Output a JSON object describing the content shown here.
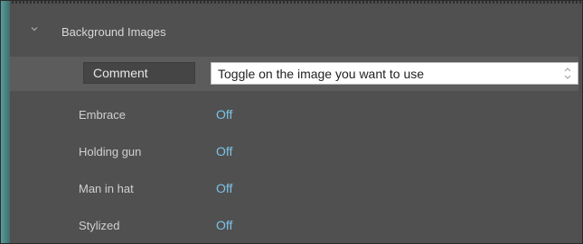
{
  "section": {
    "title": "Background Images",
    "expanded": true,
    "icon": "chevron-down-icon"
  },
  "comment": {
    "label": "Comment",
    "value": "Toggle on the image you want to use",
    "stepper_icon": "up-down-stepper-icon"
  },
  "toggles": [
    {
      "label": "Embrace",
      "value": "Off"
    },
    {
      "label": "Holding gun",
      "value": "Off"
    },
    {
      "label": "Man in hat",
      "value": "Off"
    },
    {
      "label": "Stylized",
      "value": "Off"
    }
  ],
  "colors": {
    "value_text": "#7cc3e8",
    "accent": "#5a9a9a",
    "background": "#505050"
  }
}
